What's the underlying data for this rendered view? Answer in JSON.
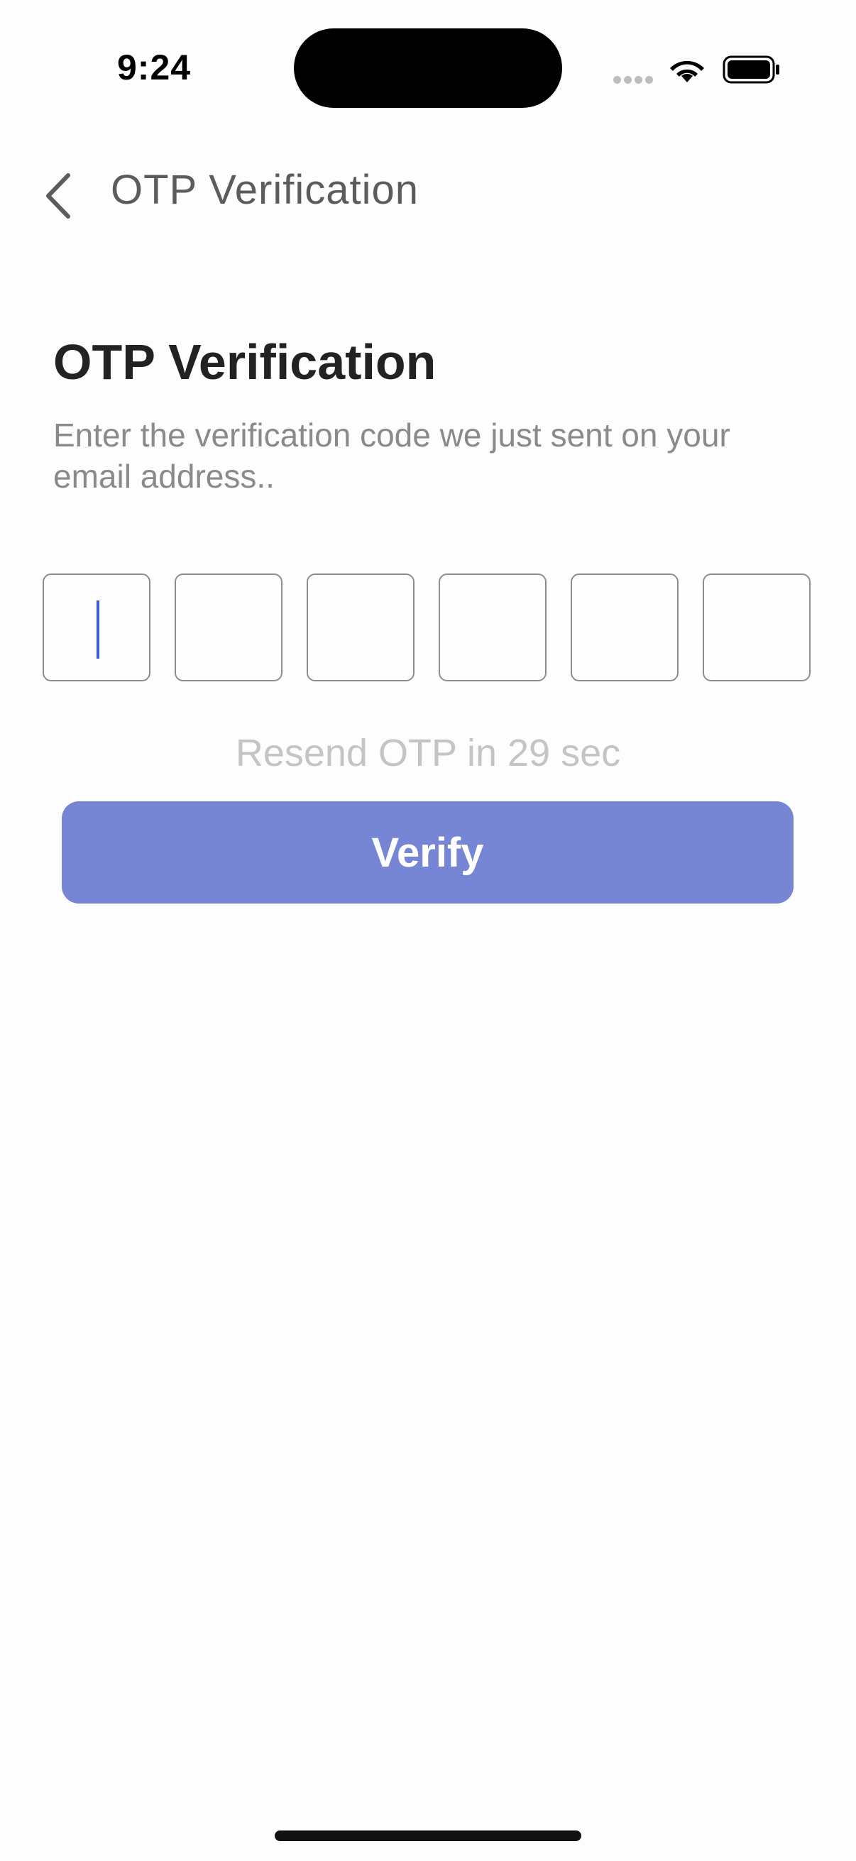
{
  "status_bar": {
    "time": "9:24",
    "icons": [
      "cellular-dots-icon",
      "wifi-icon",
      "battery-icon"
    ]
  },
  "nav": {
    "back_icon": "chevron-left-icon",
    "title": "OTP Verification"
  },
  "main": {
    "heading": "OTP Verification",
    "subtitle": "Enter the verification code we just sent on your email address..",
    "otp_digits": [
      "",
      "",
      "",
      "",
      "",
      ""
    ],
    "resend_text": "Resend OTP in 29 sec",
    "verify_label": "Verify"
  },
  "colors": {
    "accent": "#7686d4",
    "caret": "#3b5bd9",
    "nav_title": "#5c5c5c",
    "heading": "#222222",
    "subtitle": "#8a8a8a",
    "resend": "#c4c4c4",
    "background": "#fdfdfd"
  }
}
